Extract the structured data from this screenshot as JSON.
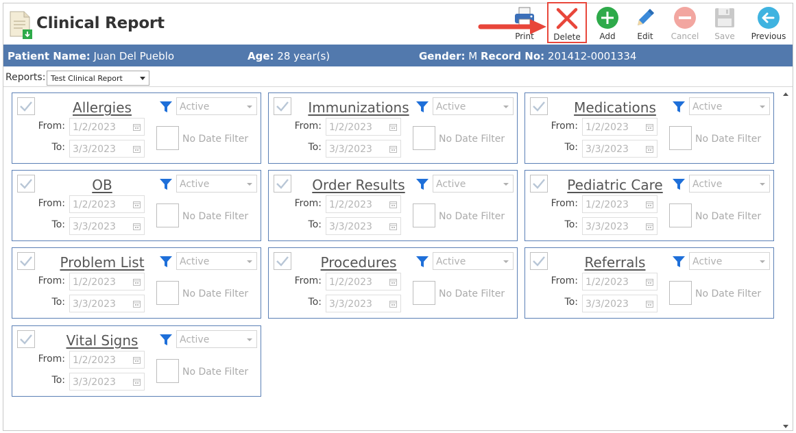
{
  "app": {
    "title": "Clinical Report"
  },
  "toolbar": {
    "print": "Print",
    "delete": "Delete",
    "add": "Add",
    "edit": "Edit",
    "cancel": "Cancel",
    "save": "Save",
    "previous": "Previous"
  },
  "patient": {
    "name_label": "Patient Name:",
    "name": "Juan Del Pueblo",
    "age_label": "Age:",
    "age": "28 year(s)",
    "gender_label": "Gender:",
    "gender": "M",
    "record_label": "Record No:",
    "record": "201412-0001334"
  },
  "reports": {
    "label": "Reports:",
    "selected": "Test Clinical Report"
  },
  "common": {
    "from_label": "From:",
    "to_label": "To:",
    "no_date_filter": "No Date Filter",
    "status": "Active",
    "from_date": "1/2/2023",
    "to_date": "3/3/2023"
  },
  "cards": [
    {
      "title": "Allergies"
    },
    {
      "title": "Immunizations"
    },
    {
      "title": "Medications"
    },
    {
      "title": "OB"
    },
    {
      "title": "Order Results"
    },
    {
      "title": "Pediatric Care"
    },
    {
      "title": "Problem List"
    },
    {
      "title": "Procedures"
    },
    {
      "title": "Referrals"
    },
    {
      "title": "Vital Signs"
    }
  ],
  "colors": {
    "patient_bar": "#5279ad",
    "card_border": "#5a7fb5",
    "highlight": "#e8463a",
    "funnel": "#1e6fd9",
    "add_green": "#2eaa4a",
    "previous_teal": "#3fb3e0"
  }
}
